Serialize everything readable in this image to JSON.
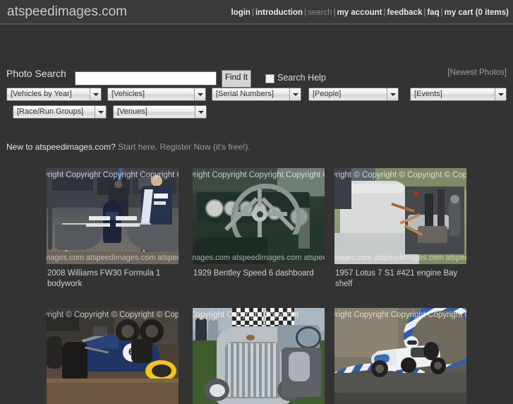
{
  "header": {
    "brand": "atspeedimages.com",
    "nav": [
      {
        "label": "login",
        "state": "active"
      },
      {
        "label": "introduction",
        "state": "active"
      },
      {
        "label": "search",
        "state": "current"
      },
      {
        "label": "my account",
        "state": "active"
      },
      {
        "label": "feedback",
        "state": "active"
      },
      {
        "label": "faq",
        "state": "active"
      },
      {
        "label": "my cart (0 items)",
        "state": "active"
      }
    ],
    "separator": "|"
  },
  "search": {
    "label": "Photo Search",
    "value": "",
    "placeholder": "",
    "button_label": "Find It",
    "help_label": "Search Help",
    "help_checked": false,
    "newest_link": "[Newest Photos]"
  },
  "filters": {
    "row1": [
      {
        "label": "[Vehicles by Year]",
        "name": "vehicles-by-year"
      },
      {
        "label": "[Vehicles]",
        "name": "vehicles"
      },
      {
        "label": "[Serial Numbers]",
        "name": "serial-numbers"
      },
      {
        "label": "[People]",
        "name": "people"
      },
      {
        "label": "[Events]",
        "name": "events"
      }
    ],
    "row2": [
      {
        "label": "[Race/Run Groups]",
        "name": "race-run-groups"
      },
      {
        "label": "[Venues]",
        "name": "venues"
      }
    ]
  },
  "promo": {
    "prefix": "New to atspeedimages.com?",
    "start_here": "Start here.",
    "register": "Register Now",
    "suffix": "(it's free!)."
  },
  "watermarks": {
    "copyright_plain": "yright Copyright Copyright Copyright Copyr",
    "copyright_symbol": "yright © Copyright © Copyright © Copyrigh",
    "copyright_symbol2": "yright © Copyright © Copyright © Copyright",
    "copyright_short": "Copyright Copyright Copyright",
    "domain_bottom": "mages.com atspeedimages.com atspeedima",
    "domain_bottom2": "mages.com atspeedimages.com atspeedim"
  },
  "gallery": {
    "rows": [
      {
        "items": [
          {
            "caption": "2008 Williams FW30 Formula 1 bodywork",
            "wm_top": "yright Copyright Copyright Copyright Copyr",
            "wm_bottom": "mages.com atspeedimages.com atspeedima"
          },
          {
            "caption": "1929 Bentley Speed 6 dashboard",
            "wm_top": "yright Copyright Copyright Copyright Copyr",
            "wm_bottom": "mages.com atspeedimages.com atspeedima"
          },
          {
            "caption": "1957 Lotus 7 S1 #421 engine Bay shelf",
            "wm_top": "yright © Copyright © Copyright © Copyrigh",
            "wm_bottom": "mages.com atspeedimages.com atspeedima"
          }
        ]
      },
      {
        "items": [
          {
            "caption": "",
            "wm_top": "yright © Copyright © Copyright © Copyright",
            "wm_bottom": ""
          },
          {
            "caption": "",
            "wm_top": "Copyright Copyright Copyright",
            "wm_bottom": ""
          },
          {
            "caption": "",
            "wm_top": "yright Copyright Copyright Copyright Copyr",
            "wm_bottom": ""
          }
        ]
      }
    ]
  },
  "colors": {
    "page_bg": "#333333",
    "header_bg": "#3a3a3a",
    "header_rule": "#555555",
    "text": "#d9d9d9",
    "muted": "#9b9b9b",
    "button_bg": "#d5d5d5"
  }
}
